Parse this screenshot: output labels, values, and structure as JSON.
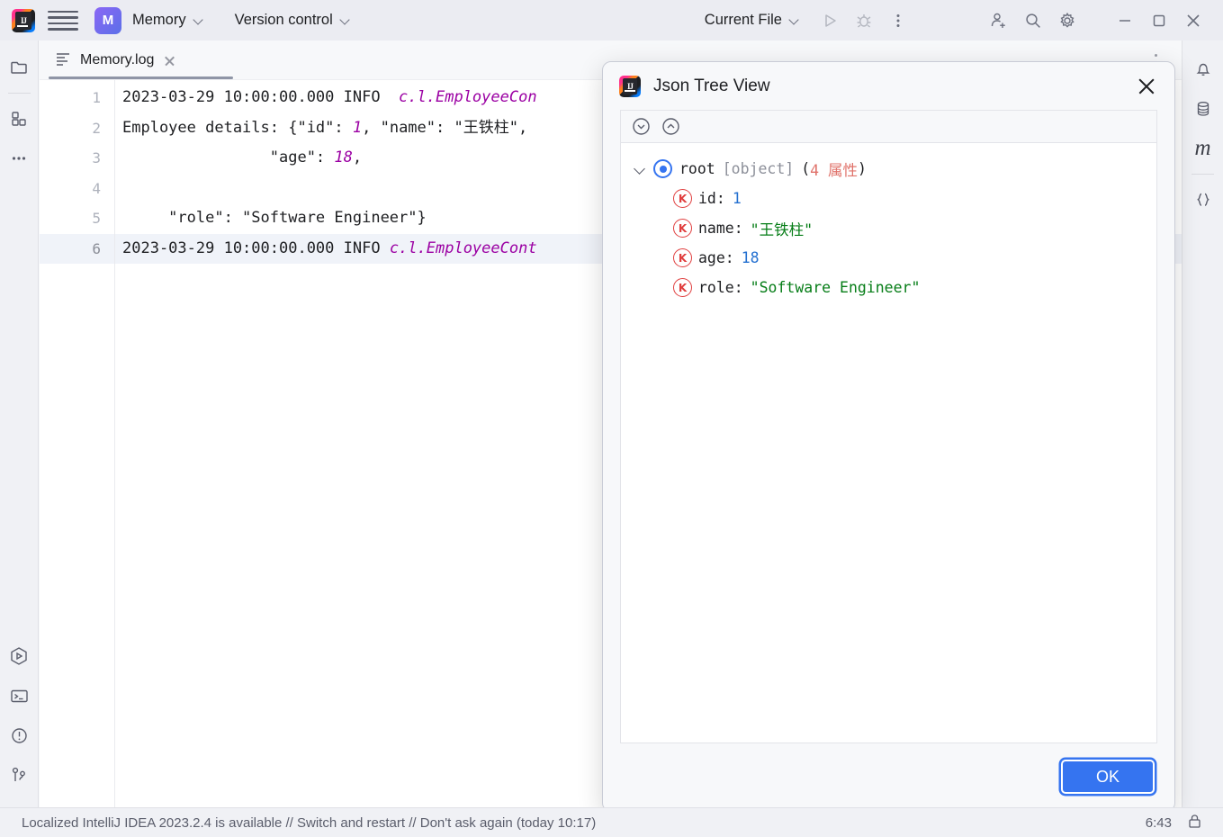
{
  "toolbar": {
    "app_logo": "intellij-idea-logo",
    "main_menu_icon": "hamburger-menu-icon",
    "project_badge": "M",
    "project_name": "Memory",
    "vcs_label": "Version control",
    "run_config_label": "Current File",
    "icons": {
      "run": "run-icon",
      "debug": "debug-icon",
      "more": "more-vertical-icon",
      "share": "add-user-icon",
      "search": "search-icon",
      "settings": "gear-icon",
      "minimize": "minimize-icon",
      "maximize": "maximize-icon",
      "close": "close-icon"
    }
  },
  "left_rail": {
    "items": [
      {
        "name": "project",
        "icon": "folder-icon"
      },
      {
        "name": "structure",
        "icon": "squares-icon"
      },
      {
        "name": "more-tool-windows",
        "icon": "ellipsis-icon"
      }
    ],
    "bottom_items": [
      {
        "name": "run",
        "icon": "run-hexagon-icon"
      },
      {
        "name": "terminal",
        "icon": "terminal-icon"
      },
      {
        "name": "problems",
        "icon": "warning-circle-icon"
      },
      {
        "name": "version-control",
        "icon": "git-branch-icon"
      }
    ]
  },
  "right_rail": {
    "items": [
      {
        "name": "notifications",
        "icon": "bell-icon"
      },
      {
        "name": "database",
        "icon": "database-icon"
      },
      {
        "name": "maven",
        "icon": "maven-m-icon"
      },
      {
        "name": "json-tools",
        "icon": "curly-braces-icon"
      }
    ]
  },
  "editor": {
    "tab": {
      "label": "Memory.log",
      "icon": "log-file-icon",
      "close": "close-icon"
    },
    "lines": [
      {
        "number": "1",
        "current": false,
        "segments": [
          {
            "text": "2023-03-29 10:00:00.000 INFO  ",
            "type": "plain"
          },
          {
            "text": "c.l.EmployeeCon",
            "type": "class"
          }
        ]
      },
      {
        "number": "2",
        "current": false,
        "segments": [
          {
            "text": "Employee details: {\"id\": ",
            "type": "plain"
          },
          {
            "text": "1",
            "type": "number"
          },
          {
            "text": ", \"name\": \"王铁柱\", ",
            "type": "plain"
          }
        ]
      },
      {
        "number": "3",
        "current": false,
        "segments": [
          {
            "text": "                \"age\": ",
            "type": "plain"
          },
          {
            "text": "18",
            "type": "number"
          },
          {
            "text": ",",
            "type": "plain"
          }
        ]
      },
      {
        "number": "4",
        "current": false,
        "segments": [
          {
            "text": "",
            "type": "plain"
          }
        ]
      },
      {
        "number": "5",
        "current": false,
        "segments": [
          {
            "text": "     \"role\": \"Software Engineer\"}",
            "type": "plain"
          }
        ]
      },
      {
        "number": "6",
        "current": true,
        "segments": [
          {
            "text": "2023-03-29 10:00:00.000 INFO ",
            "type": "plain"
          },
          {
            "text": "c.l.EmployeeCont",
            "type": "class"
          }
        ]
      }
    ]
  },
  "dialog": {
    "title": "Json Tree View",
    "icon": "intellij-idea-logo",
    "close_icon": "close-icon",
    "toolbar": {
      "expand_all": "expand-all-icon",
      "collapse_all": "collapse-all-icon"
    },
    "tree": {
      "root": {
        "key": "root",
        "type": "[object]",
        "count_open": "(",
        "count": "4 属性",
        "count_close": ")",
        "badge": "O"
      },
      "children": [
        {
          "badge": "K",
          "key": "id:",
          "value": "1",
          "value_type": "number"
        },
        {
          "badge": "K",
          "key": "name:",
          "value": "\"王铁柱\"",
          "value_type": "string"
        },
        {
          "badge": "K",
          "key": "age:",
          "value": "18",
          "value_type": "number"
        },
        {
          "badge": "K",
          "key": "role:",
          "value": "\"Software Engineer\"",
          "value_type": "string"
        }
      ]
    },
    "ok_label": "OK"
  },
  "statusbar": {
    "message": "Localized IntelliJ IDEA 2023.2.4 is available // Switch and restart // Don't ask again (today 10:17)",
    "position": "6:43",
    "lock_icon": "lock-icon"
  },
  "colors": {
    "accent": "#3574F0",
    "string": "#067D17",
    "number": "#2470D0",
    "log_token": "#9B00A3",
    "count": "#E0736B",
    "toolbar_bg": "#EBECF2"
  }
}
